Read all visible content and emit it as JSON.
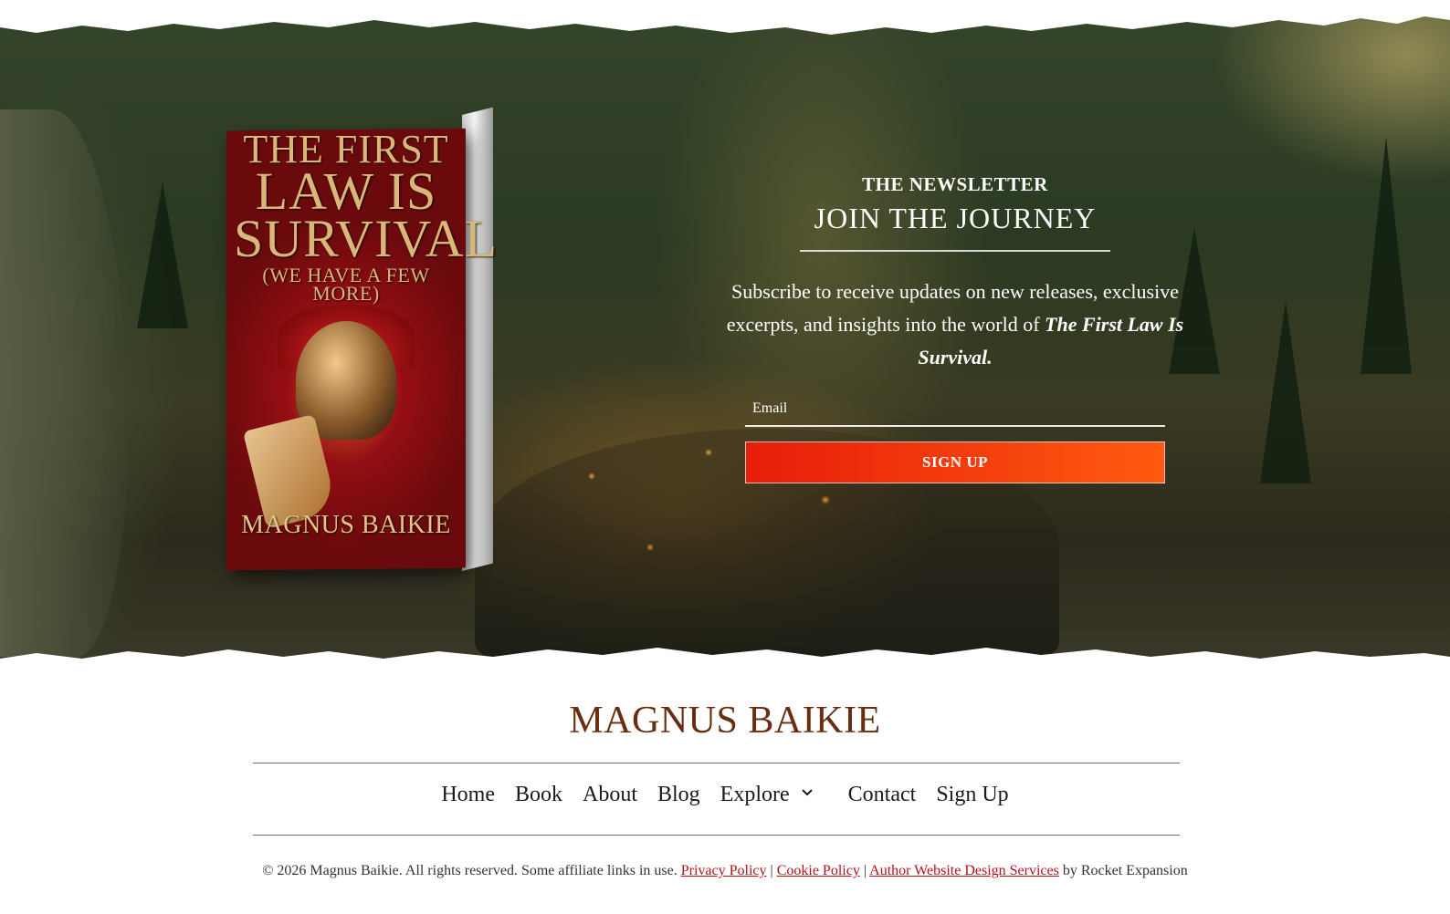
{
  "book": {
    "cover_title_line1": "THE FIRST",
    "cover_title_line2": "LAW IS",
    "cover_title_line3": "SURVIVAL",
    "cover_subtitle": "(WE HAVE A FEW MORE)",
    "cover_author": "MAGNUS BAIKIE"
  },
  "newsletter": {
    "kicker": "THE NEWSLETTER",
    "heading": "JOIN THE JOURNEY",
    "copy_before": "Subscribe to receive updates on new releases, exclusive excerpts, and insights into the world of ",
    "copy_title": "The First Law Is Survival.",
    "email_placeholder": "Email",
    "email_value": "",
    "signup_label": "SIGN UP"
  },
  "footer": {
    "brand": "MAGNUS BAIKIE",
    "nav": [
      {
        "label": "Home"
      },
      {
        "label": "Book"
      },
      {
        "label": "About"
      },
      {
        "label": "Blog"
      },
      {
        "label": "Explore"
      },
      {
        "label": "Contact"
      },
      {
        "label": "Sign Up"
      }
    ],
    "copyright_text": "© 2026 Magnus Baikie. All rights reserved. Some affiliate links in use.",
    "privacy_link": "Privacy Policy",
    "cookie_link": "Cookie Policy",
    "design_link": "Author Website Design Services",
    "separator": "|",
    "credit_text": "by Rocket Expansion"
  },
  "colors": {
    "brand": "#6a2d10",
    "button_start": "#e71d0a",
    "button_end": "#ff5a10",
    "link": "#b5121b"
  },
  "icons": {
    "explore_dropdown": "chevron-down-icon"
  }
}
